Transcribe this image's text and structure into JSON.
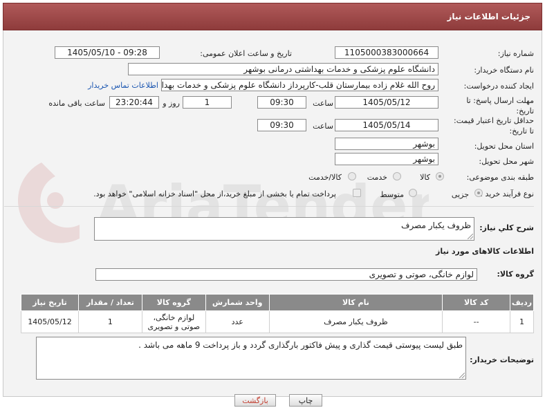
{
  "header": {
    "title": "جزئیات اطلاعات نیاز"
  },
  "fields": {
    "need_number_label": "شماره نیاز:",
    "need_number": "1105000383000664",
    "announce_label": "تاریخ و ساعت اعلان عمومی:",
    "announce_value": "1405/05/10 - 09:28",
    "buyer_org_label": "نام دستگاه خریدار:",
    "buyer_org": "دانشگاه علوم پزشکی و خدمات بهداشتی درمانی بوشهر",
    "requester_label": "ایجاد کننده درخواست:",
    "requester": "روح الله غلام زاده بیمارستان قلب-کارپرداز دانشگاه علوم پزشکی و خدمات بهداشتی درمانی بوشهر",
    "contact_link": "اطلاعات تماس خریدار",
    "deadline_label": "مهلت ارسال پاسخ: تا تاریخ:",
    "deadline_date": "1405/05/12",
    "time_label": "ساعت",
    "deadline_time": "09:30",
    "days_value": "1",
    "days_label": "روز و",
    "remaining_time": "23:20:44",
    "remaining_label": "ساعت باقی مانده",
    "validity_label": "حداقل تاریخ اعتبار قیمت: تا تاریخ:",
    "validity_date": "1405/05/14",
    "validity_time": "09:30",
    "province_label": "استان محل تحویل:",
    "province": "بوشهر",
    "city_label": "شهر محل تحویل:",
    "city": "بوشهر",
    "category_label": "طبقه بندی موضوعی:",
    "category_options": [
      "کالا",
      "خدمت",
      "کالا/خدمت"
    ],
    "process_label": "نوع فرآیند خرید :",
    "process_options": [
      "جزیی",
      "متوسط"
    ],
    "payment_note": "پرداخت تمام یا بخشی از مبلغ خرید،از محل \"اسناد خزانه اسلامی\" خواهد بود."
  },
  "summary": {
    "label": "شرح کلي نياز:",
    "value": "ظروف یکبار مصرف"
  },
  "goods_section": {
    "title": "اطلاعات کالاهای مورد نیاز"
  },
  "goods_group": {
    "label": "گروه کالا:",
    "value": "لوازم خانگی، صوتی و تصویری"
  },
  "table": {
    "headers": [
      "ردیف",
      "کد کالا",
      "نام کالا",
      "واحد شمارش",
      "گروه کالا",
      "تعداد / مقدار",
      "تاریخ نیاز"
    ],
    "rows": [
      [
        "1",
        "--",
        "ظروف یکبار مصرف",
        "عدد",
        "لوازم خانگی، صوتی و تصویری",
        "1",
        "1405/05/12"
      ]
    ]
  },
  "buyer_notes": {
    "label": "توضیحات خریدار:",
    "value": "طبق لیست پیوستی قیمت گذاری و پیش فاکتور بارگذاری گردد و باز پرداخت 9 ماهه می باشد ."
  },
  "buttons": {
    "print": "چاپ",
    "back": "بازگشت"
  },
  "watermark": {
    "text": "AriaTender.net"
  },
  "colors": {
    "header": "#9e4848",
    "table_header": "#8a8a8a",
    "link": "#1a55b0",
    "back_button_text": "#c0392b"
  }
}
